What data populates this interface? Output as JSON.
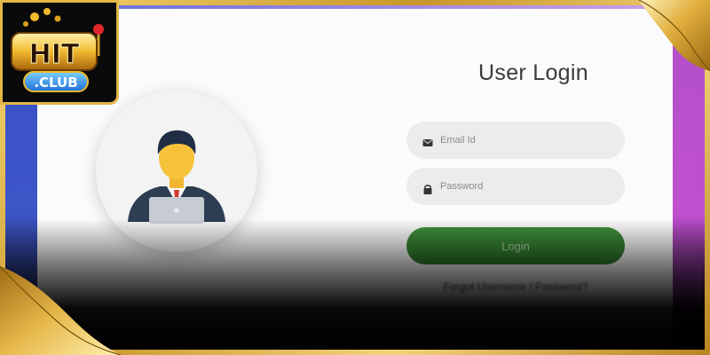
{
  "brand": {
    "logo_text": "HIT",
    "logo_sub": ".CLUB"
  },
  "login": {
    "title": "User Login",
    "email_placeholder": "Email Id",
    "password_placeholder": "Password",
    "login_label": "Login",
    "forgot_label": "Forgot Username / Password?"
  },
  "icons": {
    "avatar": "user-avatar-icon",
    "email": "envelope-icon",
    "password": "lock-icon"
  },
  "colors": {
    "accent_green": "#2e7a2b",
    "frame_gold": "#e3b645",
    "left_bar": "#3d56c8",
    "right_bar": "#c050d0"
  }
}
